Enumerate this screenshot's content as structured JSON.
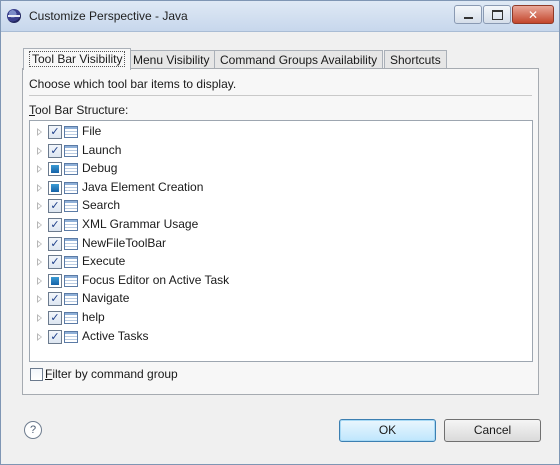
{
  "window": {
    "title": "Customize Perspective - Java",
    "close_glyph": "✕"
  },
  "tabs": [
    {
      "label": "Tool Bar Visibility",
      "active": true
    },
    {
      "label": "Menu Visibility",
      "active": false
    },
    {
      "label": "Command Groups Availability",
      "active": false
    },
    {
      "label": "Shortcuts",
      "active": false
    }
  ],
  "panel": {
    "description": "Choose which tool bar items to display.",
    "structure_label_accel": "T",
    "structure_label_rest": "ool Bar Structure:"
  },
  "tree_items": [
    {
      "label": "File",
      "state": "checked"
    },
    {
      "label": "Launch",
      "state": "checked"
    },
    {
      "label": "Debug",
      "state": "partial"
    },
    {
      "label": "Java Element Creation",
      "state": "partial"
    },
    {
      "label": "Search",
      "state": "checked"
    },
    {
      "label": "XML Grammar Usage",
      "state": "checked"
    },
    {
      "label": "NewFileToolBar",
      "state": "checked"
    },
    {
      "label": "Execute",
      "state": "checked"
    },
    {
      "label": "Focus Editor on Active Task",
      "state": "partial"
    },
    {
      "label": "Navigate",
      "state": "checked"
    },
    {
      "label": "help",
      "state": "checked"
    },
    {
      "label": "Active Tasks",
      "state": "checked"
    }
  ],
  "check_glyph": "✓",
  "filter": {
    "label_accel": "F",
    "label_rest": "ilter by command group",
    "checked": false
  },
  "help_glyph": "?",
  "buttons": {
    "ok": "OK",
    "cancel": "Cancel"
  },
  "colors": {
    "partial_fill": "#1662a8",
    "check": "#1e3f8a",
    "ok_border": "#3c7fb1"
  }
}
